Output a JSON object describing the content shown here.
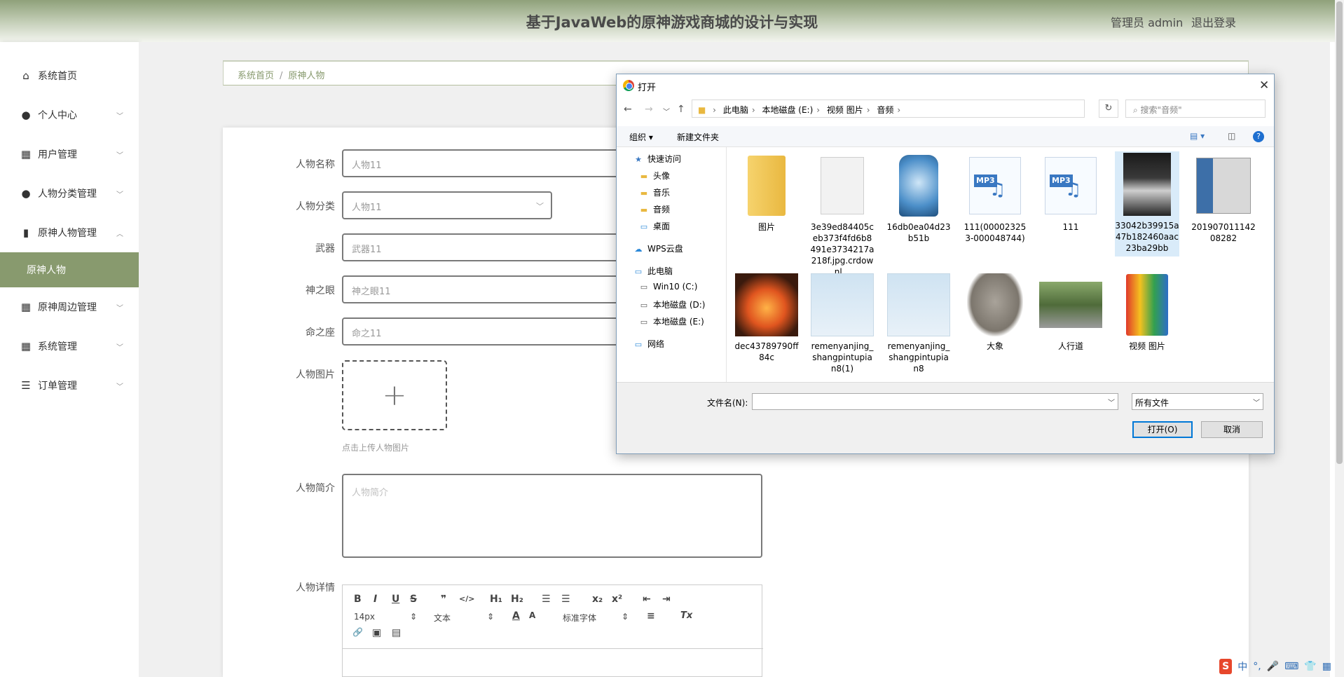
{
  "header": {
    "title": "基于JavaWeb的原神游戏商城的设计与实现",
    "admin_label": "管理员 admin",
    "logout_label": "退出登录"
  },
  "sidebar": {
    "items": [
      {
        "label": "系统首页",
        "icon": "home-icon"
      },
      {
        "label": "个人中心",
        "icon": "user-icon"
      },
      {
        "label": "用户管理",
        "icon": "grid-icon"
      },
      {
        "label": "人物分类管理",
        "icon": "user-icon"
      },
      {
        "label": "原神人物管理",
        "icon": "bar-chart-icon"
      },
      {
        "label": "原神人物",
        "icon": ""
      },
      {
        "label": "原神周边管理",
        "icon": "grid-icon"
      },
      {
        "label": "系统管理",
        "icon": "grid-icon"
      },
      {
        "label": "订单管理",
        "icon": "list-icon"
      }
    ]
  },
  "breadcrumb": {
    "home": "系统首页",
    "separator": "/",
    "current": "原神人物"
  },
  "form": {
    "name_label": "人物名称",
    "name_value": "人物11",
    "category_label": "人物分类",
    "category_value": "人物11",
    "weapon_label": "武器",
    "weapon_value": "武器11",
    "eye_label": "神之眼",
    "eye_value": "神之眼11",
    "seat_label": "命之座",
    "seat_value": "命之11",
    "image_label": "人物图片",
    "upload_plus": "+",
    "upload_tip": "点击上传人物图片",
    "intro_label": "人物简介",
    "intro_placeholder": "人物简介",
    "detail_label": "人物详情"
  },
  "editor": {
    "bold": "B",
    "italic": "I",
    "underline": "U",
    "strike": "S",
    "quote": "❞",
    "code": "</>",
    "h1": "H₁",
    "h2": "H₂",
    "ol": "☰",
    "ul": "☰",
    "sub": "x₂",
    "sup": "x²",
    "outdent": "⇤",
    "indent": "⇥",
    "size": "14px",
    "text_type": "文本",
    "font": "标准字体",
    "color": "A",
    "bg": "A",
    "align": "≡",
    "clear": "Tx",
    "link": "🔗",
    "image": "▣",
    "video": "▤"
  },
  "dialog": {
    "title": "打开",
    "close": "✕",
    "path": [
      "此电脑",
      "本地磁盘 (E:)",
      "视频 图片",
      "音频"
    ],
    "search_placeholder": "搜索\"音频\"",
    "organize": "组织 ▾",
    "new_folder": "新建文件夹",
    "tree": [
      {
        "label": "快速访问",
        "icon": "★"
      },
      {
        "label": "头像",
        "icon": "▬"
      },
      {
        "label": "音乐",
        "icon": "▬"
      },
      {
        "label": "音频",
        "icon": "▬"
      },
      {
        "label": "桌面",
        "icon": "▭"
      },
      {
        "label": "WPS云盘",
        "icon": "☁"
      },
      {
        "label": "此电脑",
        "icon": "▭"
      },
      {
        "label": "Win10 (C:)",
        "icon": "▭"
      },
      {
        "label": "本地磁盘 (D:)",
        "icon": "▭"
      },
      {
        "label": "本地磁盘 (E:)",
        "icon": "▭"
      },
      {
        "label": "网络",
        "icon": "▭"
      }
    ],
    "files": [
      {
        "name": "图片",
        "kind": "folder"
      },
      {
        "name": "3e39ed84405ceb373f4fd6b8491e3734217a218f.jpg.crdownl...",
        "kind": "doc"
      },
      {
        "name": "16db0ea04d23b51b",
        "kind": "bottle"
      },
      {
        "name": "111(000023253-000048744)",
        "kind": "mp3"
      },
      {
        "name": "111",
        "kind": "mp3"
      },
      {
        "name": "33042b39915a47b182460aac23ba29bb",
        "kind": "figure"
      },
      {
        "name": "20190701114208282",
        "kind": "machine"
      },
      {
        "name": "dec43789790ff84c",
        "kind": "fire"
      },
      {
        "name": "remenyanjing_shangpintupian8(1)",
        "kind": "glasses"
      },
      {
        "name": "remenyanjing_shangpintupian8",
        "kind": "glasses"
      },
      {
        "name": "大象",
        "kind": "elephant"
      },
      {
        "name": "人行道",
        "kind": "street"
      },
      {
        "name": "视频 图片",
        "kind": "folder2"
      }
    ],
    "mp3_tag": "MP3",
    "mp3_note": "♫",
    "filename_label": "文件名(N):",
    "filetype": "所有文件",
    "open_button": "打开(O)",
    "cancel_button": "取消"
  },
  "ime": {
    "logo": "S",
    "lang": "中",
    "punct": "°,",
    "mic": "🎤",
    "kbd": "⌨",
    "skin": "👕",
    "grid": "▦"
  }
}
